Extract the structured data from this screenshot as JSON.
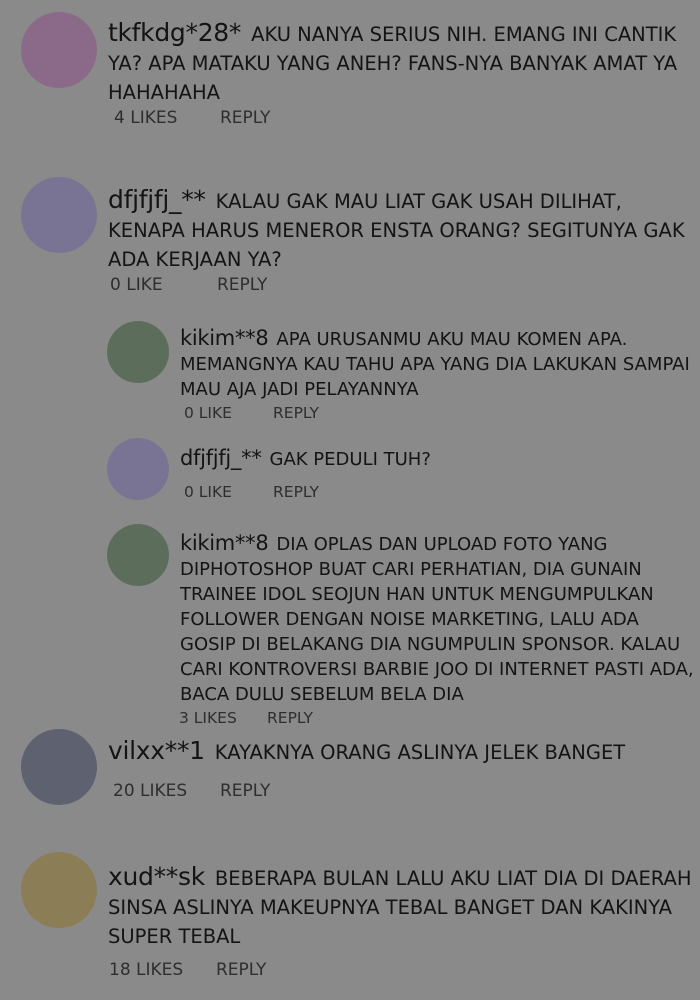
{
  "comments": [
    {
      "user": "tkfkdg*28*",
      "text": "AKU NANYA SERIUS NIH. EMANG INI CANTIK YA? APA MATAKU YANG ANEH? FANS-NYA BANYAK AMAT YA HAHAHAHA",
      "likes": "4 LIKES",
      "reply": "REPLY",
      "avatar_color": "#8a6a88"
    },
    {
      "user": "dfjfjfj_**",
      "text": "KALAU GAK MAU LIAT GAK USAH DILIHAT, KENAPA HARUS MENEROR ENSTA ORANG? SEGITUNYA GAK ADA KERJAAN YA?",
      "likes": "0 LIKE",
      "reply": "REPLY",
      "avatar_color": "#7a7494"
    },
    {
      "user": "kikim**8",
      "text": "APA URUSANMU AKU MAU KOMEN APA. MEMANGNYA KAU TAHU APA YANG DIA LAKUKAN SAMPAI MAU AJA JADI PELAYANNYA",
      "likes": "0 LIKE",
      "reply": "REPLY",
      "avatar_color": "#5d6d5b"
    },
    {
      "user": "dfjfjfj_**",
      "text": "GAK PEDULI TUH?",
      "likes": "0 LIKE",
      "reply": "REPLY",
      "avatar_color": "#7a7494"
    },
    {
      "user": "kikim**8",
      "text": "DIA OPLAS DAN UPLOAD FOTO YANG DIPHOTOSHOP BUAT CARI PERHATIAN, DIA GUNAIN TRAINEE IDOL SEOJUN HAN UNTUK MENGUMPULKAN FOLLOWER DENGAN NOISE MARKETING, LALU ADA GOSIP DI BELAKANG DIA NGUMPULIN SPONSOR. KALAU CARI KONTROVERSI BARBIE JOO DI INTERNET PASTI ADA, BACA DULU SEBELUM BELA DIA",
      "likes": "3 LIKES",
      "reply": "REPLY",
      "avatar_color": "#5d6d5b"
    },
    {
      "user": "vilxx**1",
      "text": "KAYAKNYA ORANG ASLINYA JELEK BANGET",
      "likes": "20 LIKES",
      "reply": "REPLY",
      "avatar_color": "#5e6170"
    },
    {
      "user": "xud**sk",
      "text": "BEBERAPA BULAN LALU AKU LIAT DIA DI DAERAH SINSA ASLINYA MAKEUPNYA TEBAL BANGET DAN KAKINYA SUPER TEBAL",
      "likes": "18 LIKES",
      "reply": "REPLY",
      "avatar_color": "#8b7d55"
    }
  ]
}
